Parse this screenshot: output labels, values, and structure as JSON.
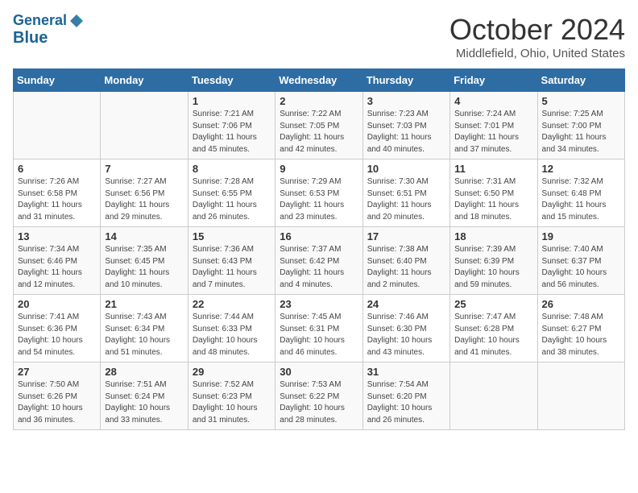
{
  "header": {
    "logo_line1": "General",
    "logo_line2": "Blue",
    "month_title": "October 2024",
    "location": "Middlefield, Ohio, United States"
  },
  "days_of_week": [
    "Sunday",
    "Monday",
    "Tuesday",
    "Wednesday",
    "Thursday",
    "Friday",
    "Saturday"
  ],
  "weeks": [
    [
      {
        "day": "",
        "info": ""
      },
      {
        "day": "",
        "info": ""
      },
      {
        "day": "1",
        "info": "Sunrise: 7:21 AM\nSunset: 7:06 PM\nDaylight: 11 hours\nand 45 minutes."
      },
      {
        "day": "2",
        "info": "Sunrise: 7:22 AM\nSunset: 7:05 PM\nDaylight: 11 hours\nand 42 minutes."
      },
      {
        "day": "3",
        "info": "Sunrise: 7:23 AM\nSunset: 7:03 PM\nDaylight: 11 hours\nand 40 minutes."
      },
      {
        "day": "4",
        "info": "Sunrise: 7:24 AM\nSunset: 7:01 PM\nDaylight: 11 hours\nand 37 minutes."
      },
      {
        "day": "5",
        "info": "Sunrise: 7:25 AM\nSunset: 7:00 PM\nDaylight: 11 hours\nand 34 minutes."
      }
    ],
    [
      {
        "day": "6",
        "info": "Sunrise: 7:26 AM\nSunset: 6:58 PM\nDaylight: 11 hours\nand 31 minutes."
      },
      {
        "day": "7",
        "info": "Sunrise: 7:27 AM\nSunset: 6:56 PM\nDaylight: 11 hours\nand 29 minutes."
      },
      {
        "day": "8",
        "info": "Sunrise: 7:28 AM\nSunset: 6:55 PM\nDaylight: 11 hours\nand 26 minutes."
      },
      {
        "day": "9",
        "info": "Sunrise: 7:29 AM\nSunset: 6:53 PM\nDaylight: 11 hours\nand 23 minutes."
      },
      {
        "day": "10",
        "info": "Sunrise: 7:30 AM\nSunset: 6:51 PM\nDaylight: 11 hours\nand 20 minutes."
      },
      {
        "day": "11",
        "info": "Sunrise: 7:31 AM\nSunset: 6:50 PM\nDaylight: 11 hours\nand 18 minutes."
      },
      {
        "day": "12",
        "info": "Sunrise: 7:32 AM\nSunset: 6:48 PM\nDaylight: 11 hours\nand 15 minutes."
      }
    ],
    [
      {
        "day": "13",
        "info": "Sunrise: 7:34 AM\nSunset: 6:46 PM\nDaylight: 11 hours\nand 12 minutes."
      },
      {
        "day": "14",
        "info": "Sunrise: 7:35 AM\nSunset: 6:45 PM\nDaylight: 11 hours\nand 10 minutes."
      },
      {
        "day": "15",
        "info": "Sunrise: 7:36 AM\nSunset: 6:43 PM\nDaylight: 11 hours\nand 7 minutes."
      },
      {
        "day": "16",
        "info": "Sunrise: 7:37 AM\nSunset: 6:42 PM\nDaylight: 11 hours\nand 4 minutes."
      },
      {
        "day": "17",
        "info": "Sunrise: 7:38 AM\nSunset: 6:40 PM\nDaylight: 11 hours\nand 2 minutes."
      },
      {
        "day": "18",
        "info": "Sunrise: 7:39 AM\nSunset: 6:39 PM\nDaylight: 10 hours\nand 59 minutes."
      },
      {
        "day": "19",
        "info": "Sunrise: 7:40 AM\nSunset: 6:37 PM\nDaylight: 10 hours\nand 56 minutes."
      }
    ],
    [
      {
        "day": "20",
        "info": "Sunrise: 7:41 AM\nSunset: 6:36 PM\nDaylight: 10 hours\nand 54 minutes."
      },
      {
        "day": "21",
        "info": "Sunrise: 7:43 AM\nSunset: 6:34 PM\nDaylight: 10 hours\nand 51 minutes."
      },
      {
        "day": "22",
        "info": "Sunrise: 7:44 AM\nSunset: 6:33 PM\nDaylight: 10 hours\nand 48 minutes."
      },
      {
        "day": "23",
        "info": "Sunrise: 7:45 AM\nSunset: 6:31 PM\nDaylight: 10 hours\nand 46 minutes."
      },
      {
        "day": "24",
        "info": "Sunrise: 7:46 AM\nSunset: 6:30 PM\nDaylight: 10 hours\nand 43 minutes."
      },
      {
        "day": "25",
        "info": "Sunrise: 7:47 AM\nSunset: 6:28 PM\nDaylight: 10 hours\nand 41 minutes."
      },
      {
        "day": "26",
        "info": "Sunrise: 7:48 AM\nSunset: 6:27 PM\nDaylight: 10 hours\nand 38 minutes."
      }
    ],
    [
      {
        "day": "27",
        "info": "Sunrise: 7:50 AM\nSunset: 6:26 PM\nDaylight: 10 hours\nand 36 minutes."
      },
      {
        "day": "28",
        "info": "Sunrise: 7:51 AM\nSunset: 6:24 PM\nDaylight: 10 hours\nand 33 minutes."
      },
      {
        "day": "29",
        "info": "Sunrise: 7:52 AM\nSunset: 6:23 PM\nDaylight: 10 hours\nand 31 minutes."
      },
      {
        "day": "30",
        "info": "Sunrise: 7:53 AM\nSunset: 6:22 PM\nDaylight: 10 hours\nand 28 minutes."
      },
      {
        "day": "31",
        "info": "Sunrise: 7:54 AM\nSunset: 6:20 PM\nDaylight: 10 hours\nand 26 minutes."
      },
      {
        "day": "",
        "info": ""
      },
      {
        "day": "",
        "info": ""
      }
    ]
  ]
}
